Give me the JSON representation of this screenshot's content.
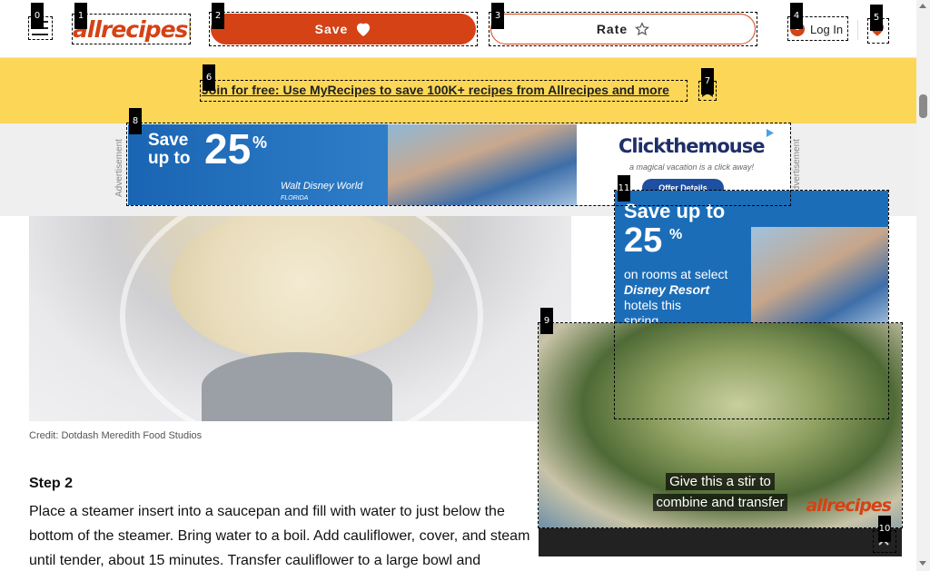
{
  "header": {
    "logo_text": "allrecipes",
    "save_label": "Save",
    "rate_label": "Rate",
    "login_label": "Log In"
  },
  "banner": {
    "link_text": "Join for free: Use MyRecipes to save 100K+ recipes from Allrecipes and more"
  },
  "top_ad": {
    "side_label": "Advertisement",
    "save_text": "Save up to",
    "percent": "25",
    "percent_sign": "%",
    "brand_line": "Walt Disney World",
    "brand_sub": "FLORIDA",
    "right_logo": "Clickthemouse",
    "right_tagline": "a magical vacation is a click away!",
    "right_button": "Offer Details"
  },
  "article": {
    "image_credit": "Credit: Dotdash Meredith Food Studios",
    "step_title": "Step 2",
    "step_text": "Place a steamer insert into a saucepan and fill with water to just below the bottom of the steamer. Bring water to a boil. Add cauliflower, cover, and steam until tender, about 15 minutes. Transfer cauliflower to a large bowl and"
  },
  "side_ad": {
    "save_text": "Save up to",
    "percent": "25",
    "percent_sign": "%",
    "copy_1": "on rooms at select",
    "copy_2": "Disney Resort",
    "copy_3": "hotels this",
    "copy_4": "spring."
  },
  "video": {
    "caption_line_1": "Give this a stir to",
    "caption_line_2": "combine and transfer",
    "logo_text": "allrecipes"
  },
  "annotations": [
    "0",
    "1",
    "2",
    "3",
    "4",
    "5",
    "6",
    "7",
    "8",
    "9",
    "10",
    "11"
  ],
  "colors": {
    "brand": "#d54215",
    "banner": "#fcd757"
  }
}
